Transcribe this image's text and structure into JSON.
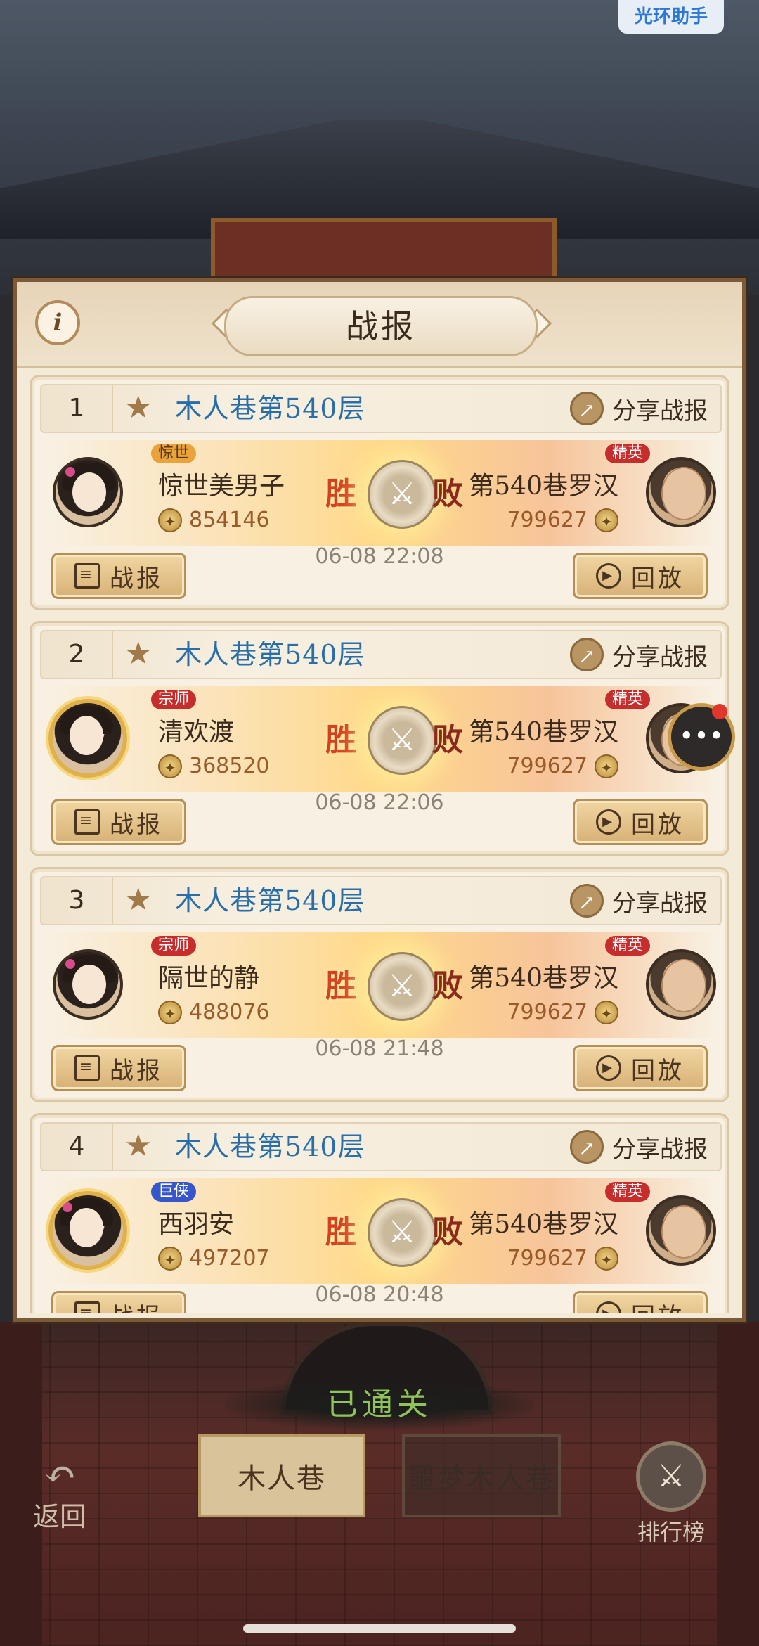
{
  "overlay": {
    "helper_label": "光环助手"
  },
  "panel": {
    "title": "战报",
    "info_icon": "i",
    "share_label": "分享战报",
    "report_label": "战报",
    "replay_label": "回放",
    "win_label": "胜",
    "lose_label": "败",
    "records": [
      {
        "index": "1",
        "stage": "木人巷第540层",
        "player": {
          "name": "惊世美男子",
          "tag": "惊世",
          "power": "854146"
        },
        "enemy": {
          "name": "第540巷罗汉",
          "tag": "精英",
          "power": "799627"
        },
        "time": "06-08 22:08"
      },
      {
        "index": "2",
        "stage": "木人巷第540层",
        "player": {
          "name": "清欢渡",
          "tag": "宗师",
          "power": "368520"
        },
        "enemy": {
          "name": "第540巷罗汉",
          "tag": "精英",
          "power": "799627"
        },
        "time": "06-08 22:06"
      },
      {
        "index": "3",
        "stage": "木人巷第540层",
        "player": {
          "name": "隔世的静",
          "tag": "宗师",
          "power": "488076"
        },
        "enemy": {
          "name": "第540巷罗汉",
          "tag": "精英",
          "power": "799627"
        },
        "time": "06-08 21:48"
      },
      {
        "index": "4",
        "stage": "木人巷第540层",
        "player": {
          "name": "西羽安",
          "tag": "巨侠",
          "power": "497207"
        },
        "enemy": {
          "name": "第540巷罗汉",
          "tag": "精英",
          "power": "799627"
        },
        "time": "06-08 20:48"
      }
    ]
  },
  "bottom": {
    "status": "已通关",
    "tabs": [
      "木人巷",
      "噩梦木人巷"
    ],
    "back_label": "返回",
    "rank_label": "排行榜"
  },
  "colors": {
    "stage_title": "#2a6ea8",
    "win": "#d6401f",
    "lose": "#8a2a1c",
    "tag_red": "#c62d2d",
    "tag_blue": "#3656c9",
    "tag_gold": "#e8a43a"
  }
}
